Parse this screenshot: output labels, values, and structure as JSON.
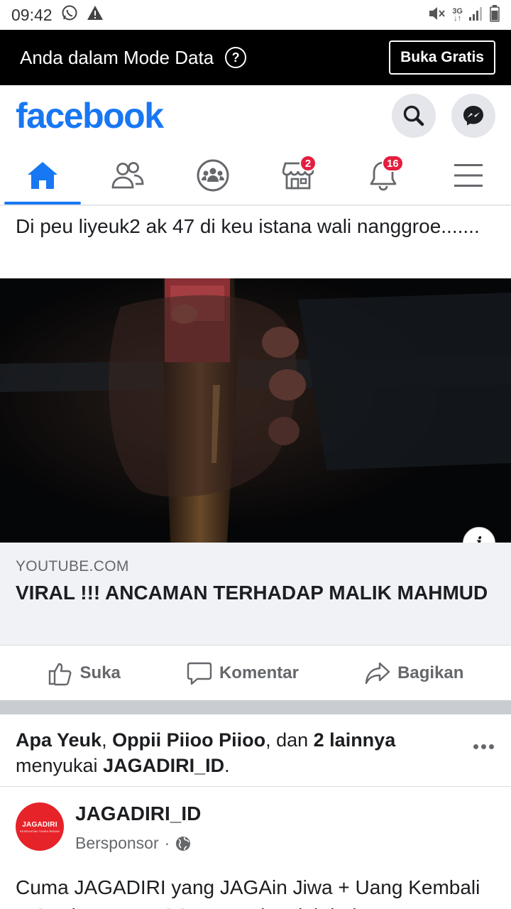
{
  "status_bar": {
    "time": "09:42",
    "network": "3G"
  },
  "data_banner": {
    "message": "Anda dalam Mode Data",
    "help_symbol": "?",
    "button_label": "Buka Gratis"
  },
  "header": {
    "logo_text": "facebook",
    "brand_color": "#1877f2"
  },
  "nav": {
    "tabs": [
      {
        "name": "home",
        "icon": "home-icon",
        "active": true
      },
      {
        "name": "friends",
        "icon": "friends-icon"
      },
      {
        "name": "groups",
        "icon": "groups-icon"
      },
      {
        "name": "marketplace",
        "icon": "marketplace-icon",
        "badge": "2"
      },
      {
        "name": "notifications",
        "icon": "bell-icon",
        "badge": "16"
      },
      {
        "name": "menu",
        "icon": "hamburger-icon"
      }
    ]
  },
  "post1": {
    "text": "Di peu liyeuk2 ak 47 di keu istana wali nanggroe.......",
    "link": {
      "domain": "YOUTUBE.COM",
      "title": "VIRAL !!! ANCAMAN TERHADAP MALIK MAHMUD",
      "info_symbol": "i"
    },
    "actions": {
      "like": "Suka",
      "comment": "Komentar",
      "share": "Bagikan"
    }
  },
  "post2": {
    "liked_by": {
      "name1": "Apa Yeuk",
      "sep1": ", ",
      "name2": "Oppii Piioo Piioo",
      "sep2": ", dan ",
      "others": "2 lainnya",
      "line2_prefix": "menyukai ",
      "page": "JAGADIRI_ID",
      "suffix": "."
    },
    "page_name": "JAGADIRI_ID",
    "avatar_text": "JAGADIRI",
    "avatar_subtext": "KESEHATAN TANPA BEBAN",
    "sponsored_label": "Bersponsor",
    "dot": "·",
    "text": "Cuma JAGADIRI yang JAGAin Jiwa + Uang Kembali + Gratis Nonton CGV. Premi mulai dari"
  }
}
